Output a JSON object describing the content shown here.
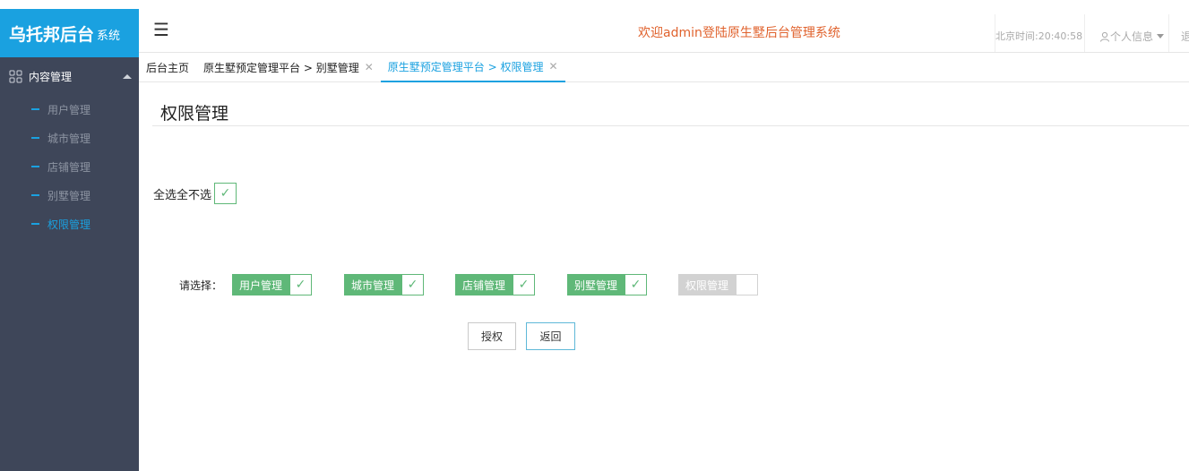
{
  "brand": {
    "title": "乌托邦后台",
    "suffix": "系统"
  },
  "sidebar": {
    "group_label": "内容管理",
    "items": [
      {
        "label": "用户管理"
      },
      {
        "label": "城市管理"
      },
      {
        "label": "店铺管理"
      },
      {
        "label": "别墅管理"
      },
      {
        "label": "权限管理"
      }
    ]
  },
  "header": {
    "menu_glyph": "☰",
    "welcome": "欢迎admin登陆原生墅后台管理系统",
    "time": "北京时间:20:40:58",
    "user": "个人信息",
    "exit": "退"
  },
  "tabs": [
    {
      "label": "后台主页"
    },
    {
      "label": "原生墅预定管理平台 > 别墅管理",
      "close": "✕"
    },
    {
      "label": "原生墅预定管理平台 > 权限管理",
      "close": "✕"
    }
  ],
  "main": {
    "title": "权限管理",
    "select_all_label": "全选全不选",
    "select_all_checked": true,
    "prompt": "请选择：",
    "options": [
      {
        "label": "用户管理",
        "checked": true
      },
      {
        "label": "城市管理",
        "checked": true
      },
      {
        "label": "店铺管理",
        "checked": true
      },
      {
        "label": "别墅管理",
        "checked": true
      },
      {
        "label": "权限管理",
        "checked": false
      }
    ],
    "authorize_label": "授权",
    "back_label": "返回"
  },
  "colors": {
    "brand": "#1aa1e0",
    "sidebar": "#3e4659",
    "accent_green": "#5fb878",
    "welcome": "#e0622d"
  },
  "check_glyph": "✓"
}
